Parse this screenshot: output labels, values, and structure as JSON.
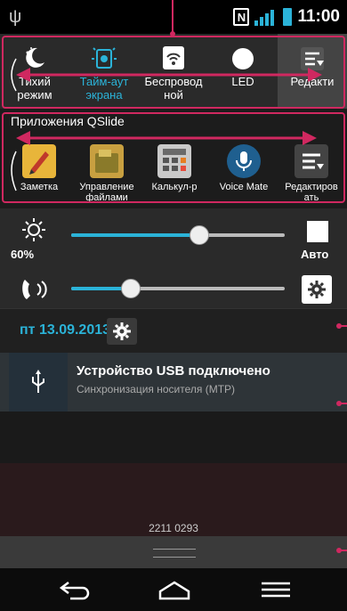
{
  "status_bar": {
    "time": "11:00",
    "nfc_label": "N",
    "usb_symbol": "ψ"
  },
  "quick_settings": {
    "items": [
      {
        "label": "Тихий режим",
        "icon": "moon-icon",
        "state": "default"
      },
      {
        "label": "Тайм-аут экрана",
        "icon": "screen-timeout-icon",
        "state": "active"
      },
      {
        "label": "Беспровод ной",
        "icon": "wireless-icon",
        "state": "default"
      },
      {
        "label": "LED",
        "icon": "led-icon",
        "state": "default"
      },
      {
        "label": "Редакти",
        "icon": "edit-list-icon",
        "state": "selected"
      }
    ]
  },
  "qslide": {
    "title": "Приложения QSlide",
    "apps": [
      {
        "label": "Заметка",
        "icon": "notepad-icon"
      },
      {
        "label": "Управление файлами",
        "icon": "file-manager-icon"
      },
      {
        "label": "Калькул-р",
        "icon": "calculator-icon"
      },
      {
        "label": "Voice Mate",
        "icon": "microphone-icon"
      },
      {
        "label": "Редактиров ать",
        "icon": "edit-list-icon"
      }
    ]
  },
  "brightness": {
    "percent_label": "60%",
    "auto_label": "Авто",
    "level": 0.6
  },
  "volume": {
    "level": 0.28
  },
  "date": {
    "text": "пт 13.09.2013"
  },
  "notification": {
    "title": "Устройство USB подключено",
    "subtitle": "Синхронизация носителя (MTP)"
  },
  "background": {
    "phone_number": "2211 0293"
  },
  "colors": {
    "accent": "#2bb3d8",
    "annotation": "#d02860"
  }
}
